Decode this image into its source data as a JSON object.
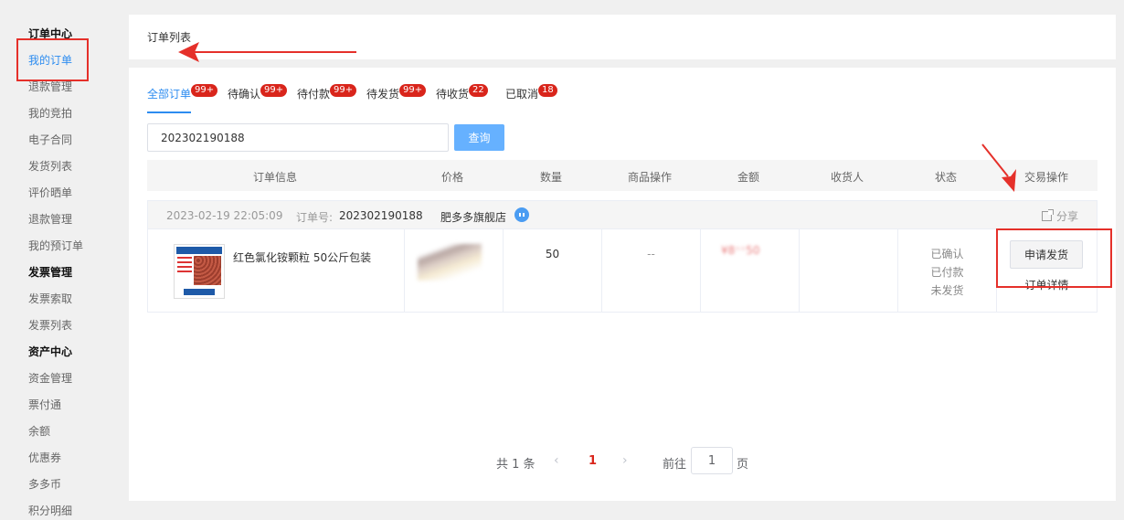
{
  "sidebar": {
    "items": [
      {
        "label": "订单中心",
        "type": "heading"
      },
      {
        "label": "我的订单",
        "type": "active"
      },
      {
        "label": "退款管理",
        "type": "item"
      },
      {
        "label": "我的竞拍",
        "type": "item"
      },
      {
        "label": "电子合同",
        "type": "item"
      },
      {
        "label": "发货列表",
        "type": "item"
      },
      {
        "label": "评价晒单",
        "type": "item"
      },
      {
        "label": "退款管理",
        "type": "item"
      },
      {
        "label": "我的预订单",
        "type": "item"
      },
      {
        "label": "发票管理",
        "type": "heading"
      },
      {
        "label": "发票索取",
        "type": "item"
      },
      {
        "label": "发票列表",
        "type": "item"
      },
      {
        "label": "资产中心",
        "type": "heading"
      },
      {
        "label": "资金管理",
        "type": "item"
      },
      {
        "label": "票付通",
        "type": "item"
      },
      {
        "label": "余额",
        "type": "item"
      },
      {
        "label": "优惠券",
        "type": "item"
      },
      {
        "label": "多多币",
        "type": "item"
      },
      {
        "label": "积分明细",
        "type": "item"
      }
    ]
  },
  "header": {
    "title": "订单列表"
  },
  "tabs": [
    {
      "label": "全部订单",
      "badge": "99+"
    },
    {
      "label": "待确认",
      "badge": "99+"
    },
    {
      "label": "待付款",
      "badge": "99+"
    },
    {
      "label": "待发货",
      "badge": "99+"
    },
    {
      "label": "待收货",
      "badge": "22"
    },
    {
      "label": "已取消",
      "badge": "18"
    }
  ],
  "search": {
    "value": "202302190188",
    "button_label": "查询"
  },
  "table": {
    "columns": [
      "订单信息",
      "价格",
      "数量",
      "商品操作",
      "金额",
      "收货人",
      "状态",
      "交易操作"
    ]
  },
  "order": {
    "date": "2023-02-19 22:05:09",
    "order_no_label": "订单号:",
    "order_no": "202302190188",
    "store": "肥多多旗舰店",
    "share_label": "分享",
    "product_name": "红色氯化铵颗粒 50公斤包装",
    "quantity": "50",
    "product_action": "--",
    "amount_visible": "¥8",
    "amount_tail": "50",
    "status": [
      "已确认",
      "已付款",
      "未发货"
    ],
    "action_button": "申请发货",
    "detail_link": "订单详情"
  },
  "pagination": {
    "total": "共 1 条",
    "prev": "‹",
    "current": "1",
    "next": "›",
    "goto_label": "前往",
    "goto_value": "1",
    "page_suffix": "页"
  },
  "colors": {
    "accent": "#2d8cf0",
    "badge": "#d9251b",
    "annotation": "#e5302a"
  }
}
